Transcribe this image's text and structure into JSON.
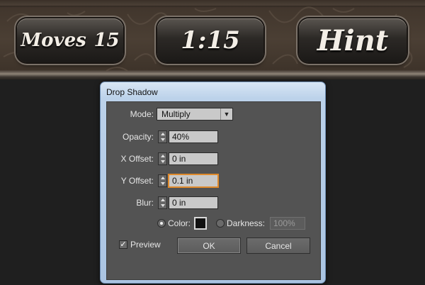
{
  "hud": {
    "moves_label": "Moves",
    "moves_value": "15",
    "timer": "1:15",
    "hint_label": "Hint"
  },
  "dialog": {
    "title": "Drop Shadow",
    "mode": {
      "label": "Mode:",
      "value": "Multiply"
    },
    "opacity": {
      "label": "Opacity:",
      "value": "40%"
    },
    "x_offset": {
      "label": "X Offset:",
      "value": "0 in"
    },
    "y_offset": {
      "label": "Y Offset:",
      "value": "0.1 in"
    },
    "blur": {
      "label": "Blur:",
      "value": "0 in"
    },
    "color_option": {
      "label": "Color:",
      "selected": true,
      "swatch": "#111111"
    },
    "darkness_option": {
      "label": "Darkness:",
      "value": "100%",
      "selected": false
    },
    "preview": {
      "label": "Preview",
      "checked": true
    },
    "ok_label": "OK",
    "cancel_label": "Cancel"
  },
  "colors": {
    "panel": "#535353",
    "frame": "#aac4e2",
    "focus": "#e08a2c"
  }
}
